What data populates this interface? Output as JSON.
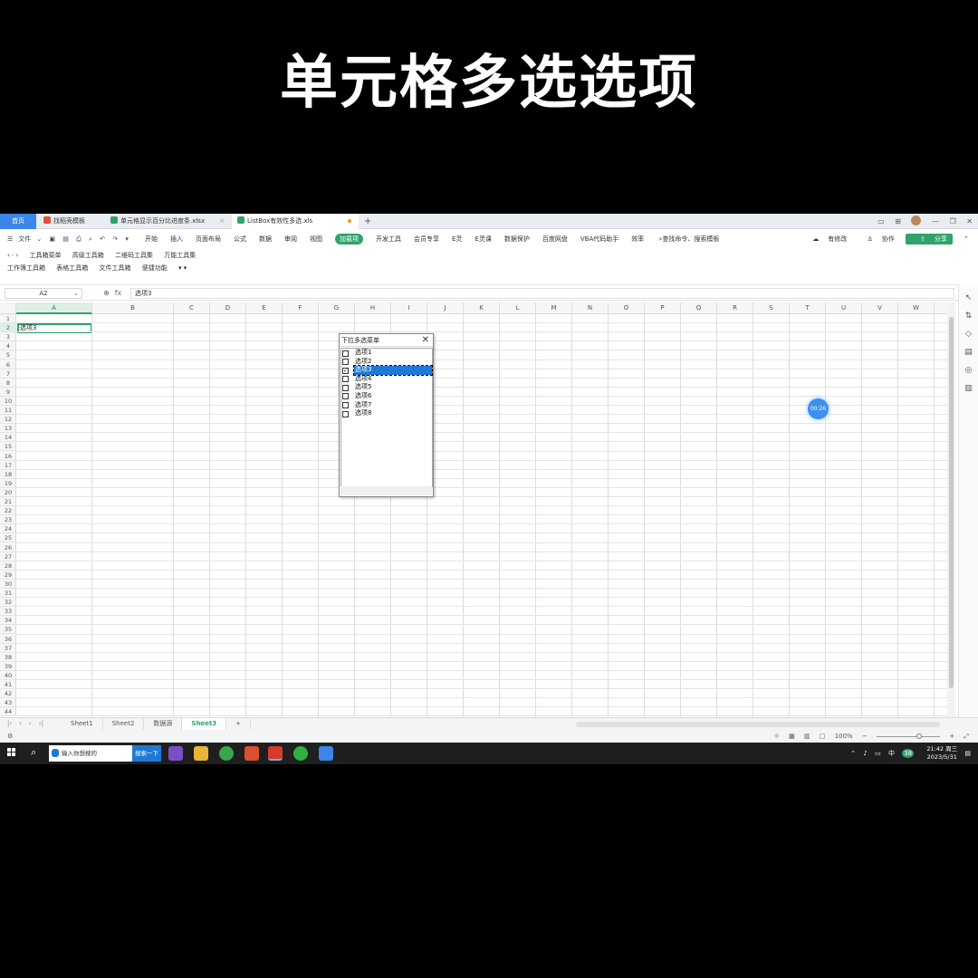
{
  "video_title": "单元格多选选项",
  "tabs": {
    "home": "首页",
    "tab1": "找稻壳模板",
    "tab2": "单元格显示百分比进度条.xlsx",
    "tab3": "ListBox有效性多选.xls"
  },
  "menu": {
    "file": "文件",
    "tabs": [
      "开始",
      "插入",
      "页面布局",
      "公式",
      "数据",
      "审阅",
      "视图",
      "加载项",
      "开发工具",
      "会员专享",
      "E灵",
      "E灵课",
      "数据保护",
      "百度网盘",
      "VBA代码助手",
      "效率"
    ],
    "active_tab": "加载项",
    "search": "查找命令、搜索模板",
    "unsaved": "有修改",
    "collab": "协作",
    "share": "分享"
  },
  "toolbar": {
    "row1": [
      "工具箱菜单",
      "高级工具箱",
      "二维码工具集",
      "万能工具集"
    ],
    "row2": [
      "工作簿工具箱",
      "表格工具箱",
      "文件工具箱",
      "便捷功能"
    ]
  },
  "formula_bar": {
    "name_box": "A2",
    "fx": "fx",
    "content": "选项3"
  },
  "grid": {
    "columns": [
      "A",
      "B",
      "C",
      "D",
      "E",
      "F",
      "G",
      "H",
      "I",
      "J",
      "K",
      "L",
      "M",
      "N",
      "O",
      "P",
      "Q",
      "R",
      "S",
      "T",
      "U",
      "V",
      "W"
    ],
    "rows": [
      "1",
      "2",
      "3",
      "4",
      "5",
      "6",
      "7",
      "8",
      "9",
      "10",
      "11",
      "12",
      "13",
      "14",
      "15",
      "16",
      "17",
      "18",
      "19",
      "20",
      "21",
      "22",
      "23",
      "24",
      "25",
      "26",
      "27",
      "28",
      "29",
      "30",
      "31",
      "32",
      "33",
      "34",
      "35",
      "36",
      "37",
      "38",
      "39",
      "40",
      "41",
      "42",
      "43",
      "44"
    ],
    "active_cell_value": "选项3"
  },
  "popup": {
    "title": "下拉多选菜单",
    "items": [
      {
        "label": "选项1",
        "checked": false
      },
      {
        "label": "选项2",
        "checked": false
      },
      {
        "label": "选项3",
        "checked": true
      },
      {
        "label": "选项4",
        "checked": false
      },
      {
        "label": "选项5",
        "checked": false
      },
      {
        "label": "选项6",
        "checked": false
      },
      {
        "label": "选项7",
        "checked": false
      },
      {
        "label": "选项8",
        "checked": false
      }
    ]
  },
  "timer": "00:26",
  "sheets": [
    "Sheet1",
    "Sheet2",
    "数据源",
    "Sheet3"
  ],
  "active_sheet": "Sheet3",
  "statusbar": {
    "zoom": "100%"
  },
  "taskbar": {
    "search_placeholder": "输入你想搜的",
    "search_button": "搜索一下",
    "ime": "中",
    "badge": "38",
    "time": "21:42 周三",
    "date": "2023/5/31"
  }
}
